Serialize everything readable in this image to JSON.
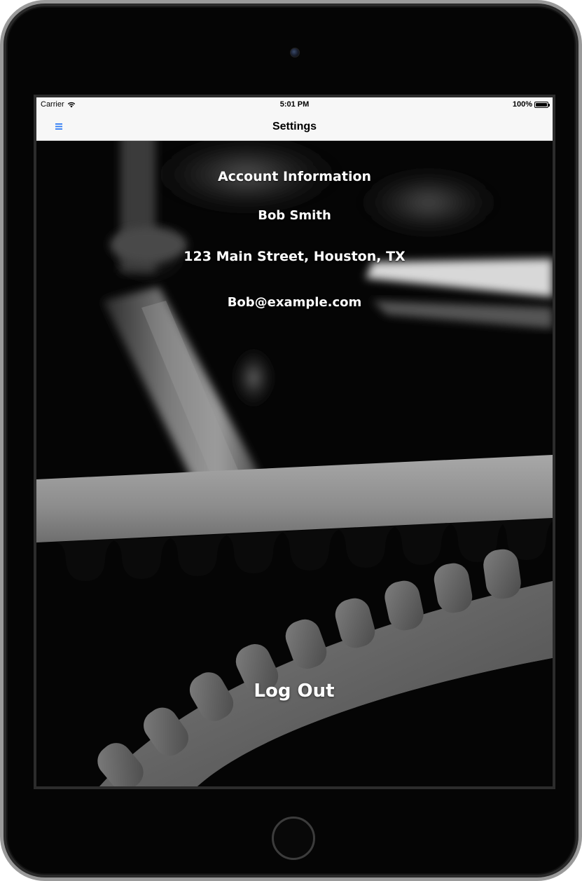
{
  "status_bar": {
    "carrier": "Carrier",
    "time": "5:01 PM",
    "battery": "100%",
    "battery_level": 1.0
  },
  "nav_bar": {
    "title": "Settings",
    "menu_icon": "hamburger-menu-icon",
    "accent_color": "#2f7cf6"
  },
  "account": {
    "heading": "Account Information",
    "name": "Bob Smith",
    "address": "123 Main Street, Houston, TX",
    "email": "Bob@example.com"
  },
  "actions": {
    "logout_label": "Log Out"
  },
  "colors": {
    "text_on_background": "#ffffff",
    "bar_background": "#f7f7f7",
    "device_frame": "#050505"
  }
}
